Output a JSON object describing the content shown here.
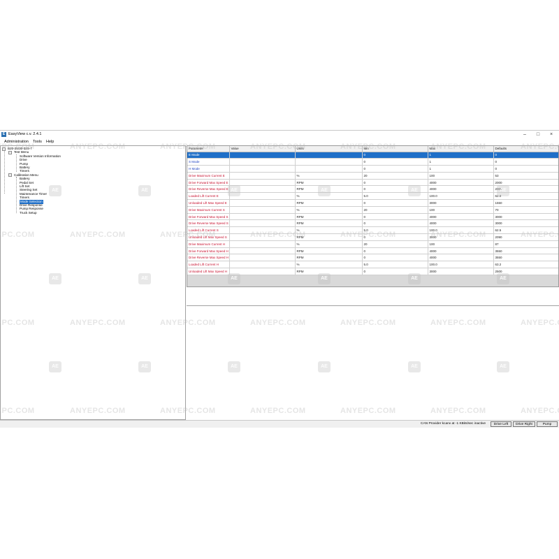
{
  "window": {
    "title": "EasyView c.v. 2.4.1",
    "controls": {
      "minimize": "–",
      "maximize": "□",
      "close": "×"
    }
  },
  "menu": [
    "Administration",
    "Tools",
    "Help"
  ],
  "tree": {
    "root": "B20-25/30-32S-7",
    "groups": [
      {
        "label": "Test Menu",
        "items": [
          "Software Version Information",
          "Drive",
          "Pump",
          "Battery",
          "Timers"
        ]
      },
      {
        "label": "Calibration Menu",
        "items": [
          "Battery",
          "Pedal Set",
          "Lift Set",
          "Steering Set",
          "Maintenance Timer",
          "Timers",
          "Mode Selection",
          "Drive Response",
          "Pump Response",
          "Truck Setup"
        ]
      }
    ],
    "selected": "Mode Selection"
  },
  "grid": {
    "columns": [
      "Parameter",
      "Value",
      "Units",
      "Min",
      "Max",
      "Defaults"
    ],
    "rows": [
      [
        "E Mode",
        "",
        "",
        "0",
        "1",
        "0"
      ],
      [
        "S Mode",
        "",
        "",
        "0",
        "1",
        "0"
      ],
      [
        "H Mode",
        "",
        "",
        "0",
        "1",
        "0"
      ],
      [
        "Drive Maximum Current E",
        "",
        "%",
        "20",
        "100",
        "53"
      ],
      [
        "Drive Forward Max Speed E",
        "",
        "RPM",
        "0",
        "4000",
        "2000"
      ],
      [
        "Drive Reverse Max Speed E",
        "",
        "RPM",
        "0",
        "4000",
        "2000"
      ],
      [
        "Loaded Lift Current E",
        "",
        "%",
        "5.0",
        "100.0",
        "62.0"
      ],
      [
        "Unloaded Lift Max Speed E",
        "",
        "RPM",
        "0",
        "3000",
        "1550"
      ],
      [
        "Drive Maximum Current S",
        "",
        "%",
        "20",
        "100",
        "70"
      ],
      [
        "Drive Forward Max Speed S",
        "",
        "RPM",
        "0",
        "4000",
        "3000"
      ],
      [
        "Drive Reverse Max Speed S",
        "",
        "RPM",
        "0",
        "4000",
        "3000"
      ],
      [
        "Loaded Lift Current S",
        "",
        "%",
        "5.0",
        "100.0",
        "62.5"
      ],
      [
        "Unloaded Lift Max Speed S",
        "",
        "RPM",
        "0",
        "3000",
        "2090"
      ],
      [
        "Drive Maximum Current H",
        "",
        "%",
        "20",
        "100",
        "87"
      ],
      [
        "Drive Forward Max Speed H",
        "",
        "RPM",
        "0",
        "4000",
        "3550"
      ],
      [
        "Drive Reverse Max Speed H",
        "",
        "RPM",
        "0",
        "4000",
        "3550"
      ],
      [
        "Loaded Lift Current H",
        "",
        "%",
        "5.0",
        "100.0",
        "63.2"
      ],
      [
        "Unloaded Lift Max Speed H",
        "",
        "RPM",
        "0",
        "3000",
        "2500"
      ]
    ],
    "selected_row": 0,
    "colors": {
      "parameter_red": "#c8102e",
      "parameter_blue": "#1a3fbf",
      "selection": "#1f6fc8"
    }
  },
  "status": {
    "text": "CAN Provider kcanv at -1 KBits/sec inactive",
    "buttons": [
      "Drive Left",
      "Drive Right",
      "Pump"
    ]
  },
  "watermark": {
    "text": "ANYEPC.COM",
    "badge": "AE"
  }
}
